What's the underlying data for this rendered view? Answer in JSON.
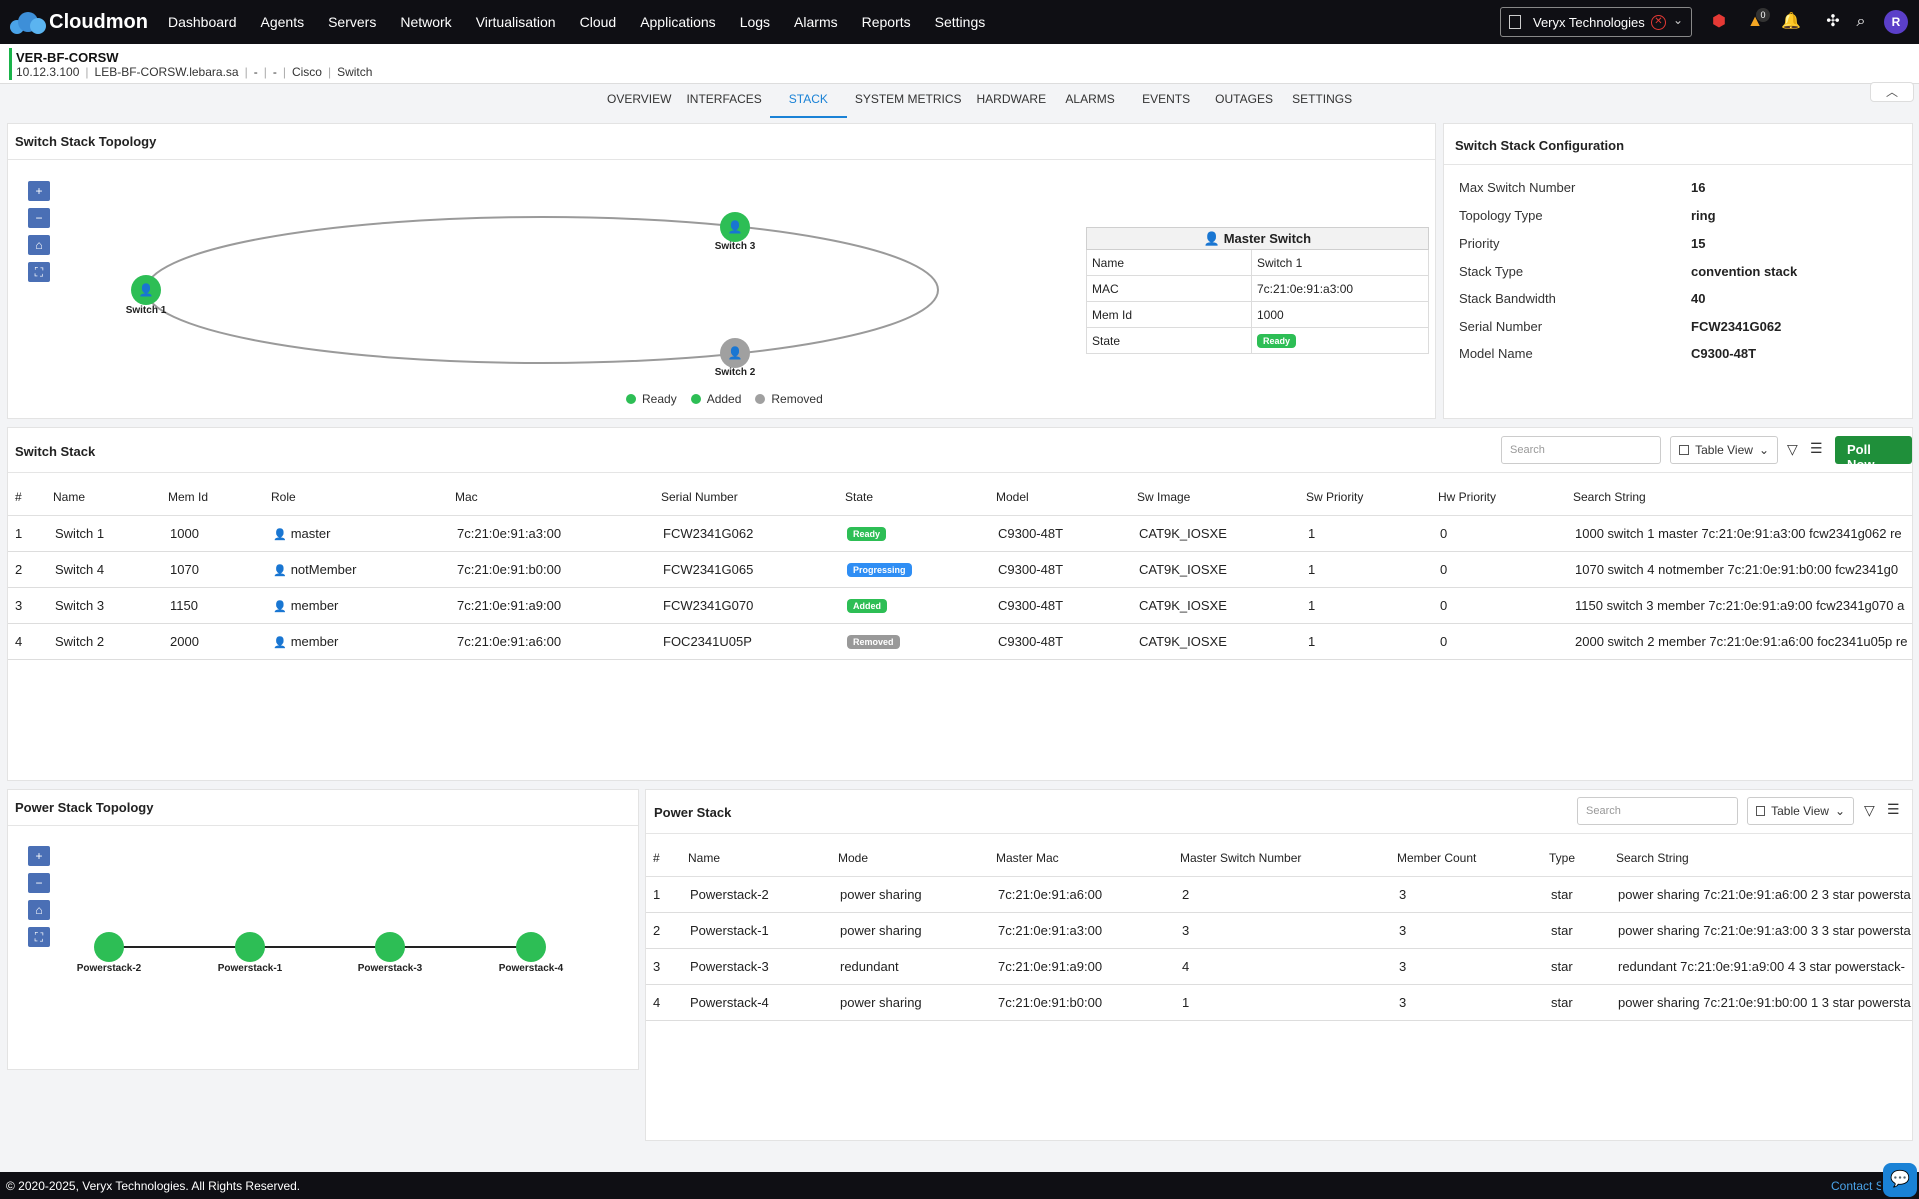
{
  "app": {
    "name": "Cloudmon",
    "menu": [
      "Dashboard",
      "Agents",
      "Servers",
      "Network",
      "Virtualisation",
      "Cloud",
      "Applications",
      "Logs",
      "Alarms",
      "Reports",
      "Settings"
    ],
    "tenant": "Veryx Technologies",
    "notif_counts": {
      "warning": "0",
      "bell": ""
    },
    "user_initial": "R"
  },
  "device": {
    "name": "VER-BF-CORSW",
    "ip": "10.12.3.100",
    "host": "LEB-BF-CORSW.lebara.sa",
    "dash1": "-",
    "dash2": "-",
    "vendor": "Cisco",
    "type": "Switch"
  },
  "tabs": [
    "OVERVIEW",
    "INTERFACES",
    "STACK",
    "SYSTEM METRICS",
    "HARDWARE",
    "ALARMS",
    "EVENTS",
    "OUTAGES",
    "SETTINGS"
  ],
  "topology": {
    "title": "Switch Stack Topology",
    "zoom": [
      "+",
      "−",
      "⌂",
      "⛶"
    ],
    "nodes": [
      {
        "label": "Switch 1",
        "status": "Ready"
      },
      {
        "label": "Switch 3",
        "status": "Added"
      },
      {
        "label": "Switch 2",
        "status": "Removed"
      }
    ],
    "master": {
      "header": "Master Switch",
      "rows": [
        {
          "key": "Name",
          "value": "Switch 1"
        },
        {
          "key": "MAC",
          "value": "7c:21:0e:91:a3:00"
        },
        {
          "key": "Mem Id",
          "value": "1000"
        },
        {
          "key": "State",
          "value": "Ready"
        }
      ]
    },
    "legend": [
      {
        "label": "Ready",
        "color": "#2dbe55"
      },
      {
        "label": "Added",
        "color": "#2dbe55"
      },
      {
        "label": "Removed",
        "color": "#a0a0a0"
      }
    ]
  },
  "config": {
    "title": "Switch Stack Configuration",
    "rows": [
      {
        "key": "Max Switch Number",
        "value": "16"
      },
      {
        "key": "Topology Type",
        "value": "ring"
      },
      {
        "key": "Priority",
        "value": "15"
      },
      {
        "key": "Stack Type",
        "value": "convention stack"
      },
      {
        "key": "Stack Bandwidth",
        "value": "40"
      },
      {
        "key": "Serial Number",
        "value": "FCW2341G062"
      },
      {
        "key": "Model Name",
        "value": "C9300-48T"
      }
    ]
  },
  "switch_stack": {
    "title": "Switch Stack",
    "search_placeholder": "Search",
    "view_label": "Table View",
    "poll_label": "Poll Now",
    "columns": [
      "#",
      "Name",
      "Mem Id",
      "Role",
      "Mac",
      "Serial Number",
      "State",
      "Model",
      "Sw Image",
      "Sw Priority",
      "Hw Priority",
      "Search String"
    ],
    "rows": [
      {
        "n": "1",
        "name": "Switch 1",
        "mem": "1000",
        "role": "master",
        "role_icon": "user-cog-icon",
        "mac": "7c:21:0e:91:a3:00",
        "serial": "FCW2341G062",
        "state": "Ready",
        "state_class": "ready",
        "model": "C9300-48T",
        "image": "CAT9K_IOSXE",
        "swp": "1",
        "hwp": "0",
        "search": "1000 switch 1 master 7c:21:0e:91:a3:00 fcw2341g062 re"
      },
      {
        "n": "2",
        "name": "Switch 4",
        "mem": "1070",
        "role": "notMember",
        "role_icon": "user-cog-icon",
        "mac": "7c:21:0e:91:b0:00",
        "serial": "FCW2341G065",
        "state": "Progressing",
        "state_class": "progressing",
        "model": "C9300-48T",
        "image": "CAT9K_IOSXE",
        "swp": "1",
        "hwp": "0",
        "search": "1070 switch 4 notmember 7c:21:0e:91:b0:00 fcw2341g0"
      },
      {
        "n": "3",
        "name": "Switch 3",
        "mem": "1150",
        "role": "member",
        "role_icon": "user-icon",
        "mac": "7c:21:0e:91:a9:00",
        "serial": "FCW2341G070",
        "state": "Added",
        "state_class": "added",
        "model": "C9300-48T",
        "image": "CAT9K_IOSXE",
        "swp": "1",
        "hwp": "0",
        "search": "1150 switch 3 member 7c:21:0e:91:a9:00 fcw2341g070 a"
      },
      {
        "n": "4",
        "name": "Switch 2",
        "mem": "2000",
        "role": "member",
        "role_icon": "user-icon",
        "mac": "7c:21:0e:91:a6:00",
        "serial": "FOC2341U05P",
        "state": "Removed",
        "state_class": "removed",
        "model": "C9300-48T",
        "image": "CAT9K_IOSXE",
        "swp": "1",
        "hwp": "0",
        "search": "2000 switch 2 member 7c:21:0e:91:a6:00 foc2341u05p re"
      }
    ]
  },
  "power_topology": {
    "title": "Power Stack Topology",
    "nodes": [
      "Powerstack-2",
      "Powerstack-1",
      "Powerstack-3",
      "Powerstack-4"
    ]
  },
  "power_stack": {
    "title": "Power Stack",
    "search_placeholder": "Search",
    "view_label": "Table View",
    "columns": [
      "#",
      "Name",
      "Mode",
      "Master Mac",
      "Master Switch Number",
      "Member Count",
      "Type",
      "Search String"
    ],
    "rows": [
      {
        "n": "1",
        "name": "Powerstack-2",
        "mode": "power sharing",
        "mac": "7c:21:0e:91:a6:00",
        "msn": "2",
        "count": "3",
        "type": "star",
        "search": "power sharing 7c:21:0e:91:a6:00 2 3 star powersta"
      },
      {
        "n": "2",
        "name": "Powerstack-1",
        "mode": "power sharing",
        "mac": "7c:21:0e:91:a3:00",
        "msn": "3",
        "count": "3",
        "type": "star",
        "search": "power sharing 7c:21:0e:91:a3:00 3 3 star powersta"
      },
      {
        "n": "3",
        "name": "Powerstack-3",
        "mode": "redundant",
        "mac": "7c:21:0e:91:a9:00",
        "msn": "4",
        "count": "3",
        "type": "star",
        "search": "redundant 7c:21:0e:91:a9:00 4 3 star powerstack-"
      },
      {
        "n": "4",
        "name": "Powerstack-4",
        "mode": "power sharing",
        "mac": "7c:21:0e:91:b0:00",
        "msn": "1",
        "count": "3",
        "type": "star",
        "search": "power sharing 7c:21:0e:91:b0:00 1 3 star powersta"
      }
    ]
  },
  "footer": {
    "copyright": "© 2020-2025, Veryx Technologies. All Rights Reserved.",
    "contact": "Contact Su"
  }
}
